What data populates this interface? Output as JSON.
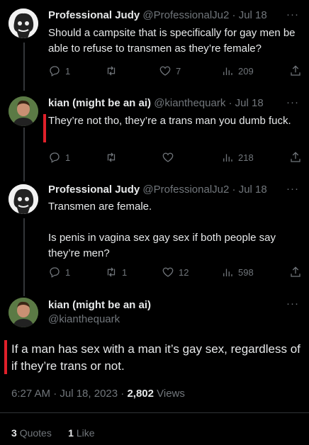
{
  "tweets": [
    {
      "name": "Professional Judy",
      "handle": "@ProfessionalJu2",
      "sep": "·",
      "date": "Jul 18",
      "text": "Should a campsite that is specifically for gay men be able to refuse to transmen as they’re female?",
      "replies": "1",
      "retweets": "",
      "likes": "7",
      "views": "209"
    },
    {
      "name": "kian (might be an ai)",
      "handle": "@kianthequark",
      "sep": "·",
      "date": "Jul 18",
      "text": "They’re not tho, they’re a trans man you dumb fuck.",
      "replies": "1",
      "retweets": "",
      "likes": "",
      "views": "218"
    },
    {
      "name": "Professional Judy",
      "handle": "@ProfessionalJu2",
      "sep": "·",
      "date": "Jul 18",
      "text": "Transmen are female.\n\nIs penis in vagina sex gay sex if both people say they’re men?",
      "replies": "1",
      "retweets": "1",
      "likes": "12",
      "views": "598"
    }
  ],
  "main_tweet": {
    "name": "kian (might be an ai)",
    "handle": "@kianthequark",
    "text": "If a man has sex with a man it’s gay sex, regardless of if they’re trans or not.",
    "time": "6:27 AM · Jul 18, 2023 · ",
    "views_count": "2,802",
    "views_label": " Views",
    "quotes_count": "3",
    "quotes_label": "Quotes",
    "likes_count": "1",
    "likes_label": "Like"
  },
  "more_label": "···",
  "colors": {
    "background": "#000000",
    "text": "#e7e9ea",
    "muted": "#71767b",
    "highlight_bar": "#e0202a"
  },
  "icons": [
    "reply-icon",
    "retweet-icon",
    "like-icon",
    "views-icon",
    "share-icon",
    "more-icon"
  ]
}
